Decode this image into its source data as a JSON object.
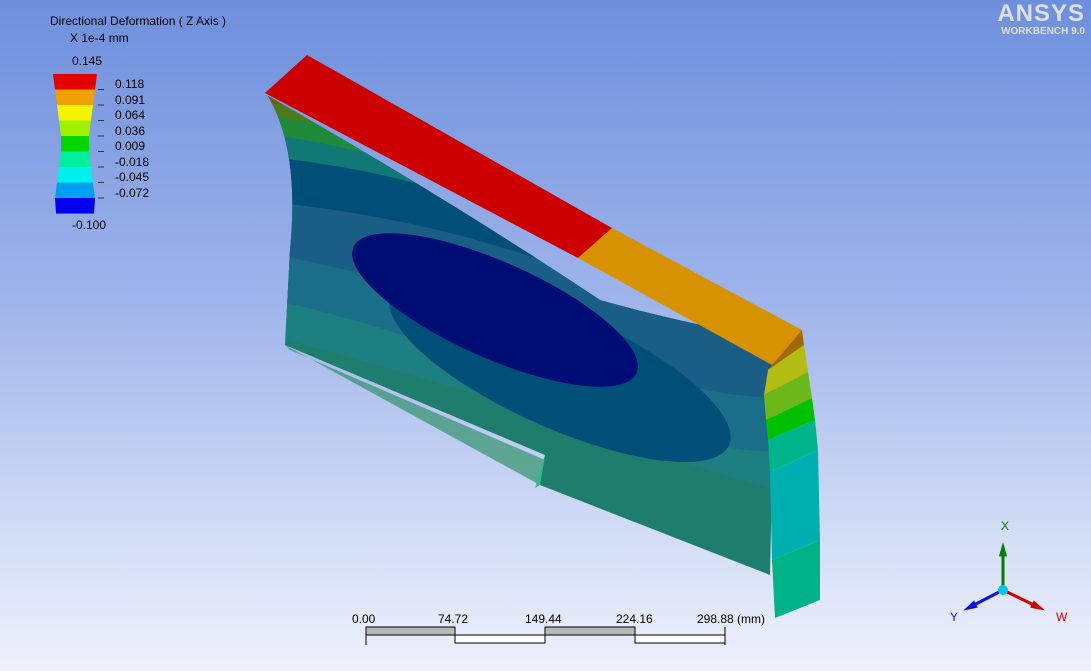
{
  "legend": {
    "title": "Directional Deformation ( Z Axis )",
    "unit": "X 1e-4 mm",
    "max": "0.145",
    "min": "-0.100",
    "ticks": [
      "0.118",
      "0.091",
      "0.064",
      "0.036",
      "0.009",
      "-0.018",
      "-0.045",
      "-0.072"
    ],
    "colors": [
      "#e20000",
      "#f0a000",
      "#f4f400",
      "#a0f000",
      "#00d800",
      "#00f0a0",
      "#00f0f0",
      "#00a0f0",
      "#0000f0"
    ]
  },
  "logo": {
    "name": "ANSYS",
    "product": "WORKBENCH 9.0"
  },
  "scale_bar": {
    "labels": [
      "0.00",
      "74.72",
      "149.44",
      "224.16",
      "298.88 (mm)"
    ]
  },
  "triad": {
    "x": "X",
    "y": "Y",
    "w": "W",
    "colors": {
      "x": "#008000",
      "y": "#1010e0",
      "w": "#d00000",
      "center": "#00c8e8"
    }
  }
}
